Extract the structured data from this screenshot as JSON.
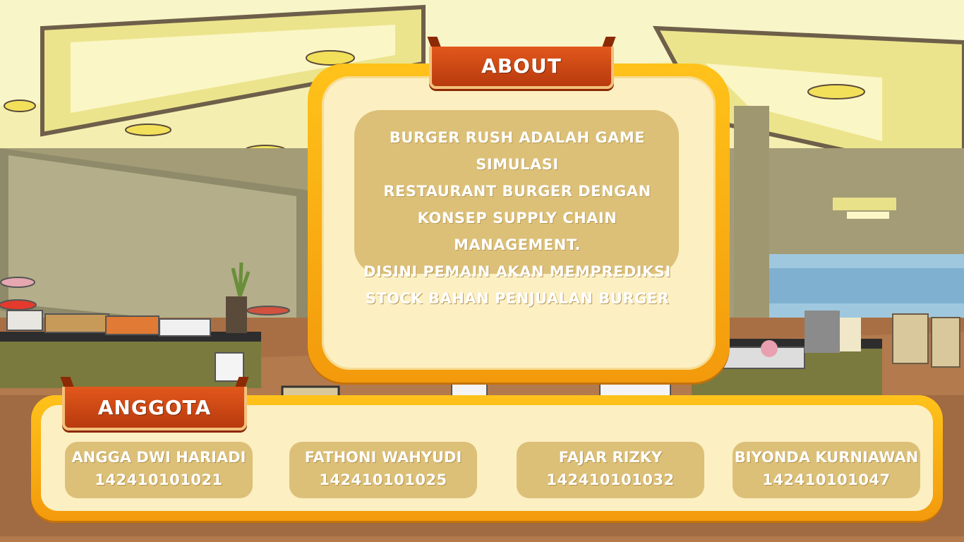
{
  "about": {
    "title": "ABOUT",
    "lines": [
      "BURGER RUSH ADALAH GAME SIMULASI",
      "RESTAURANT BURGER DENGAN",
      "KONSEP SUPPLY CHAIN MANAGEMENT.",
      "DISINI PEMAIN AKAN MEMPREDIKSI",
      "STOCK BAHAN PENJUALAN BURGER"
    ]
  },
  "anggota": {
    "title": "ANGGOTA",
    "members": [
      {
        "name": "ANGGA DWI HARIADI",
        "nim": "142410101021"
      },
      {
        "name": "FATHONI WAHYUDI",
        "nim": "142410101025"
      },
      {
        "name": "FAJAR RIZKY",
        "nim": "142410101032"
      },
      {
        "name": "BIYONDA KURNIAWAN",
        "nim": "142410101047"
      }
    ]
  },
  "colors": {
    "frame_orange": "#f7a90f",
    "panel_cream": "#fcefc2",
    "text_box": "#dcc078",
    "tab_red": "#c94412"
  }
}
